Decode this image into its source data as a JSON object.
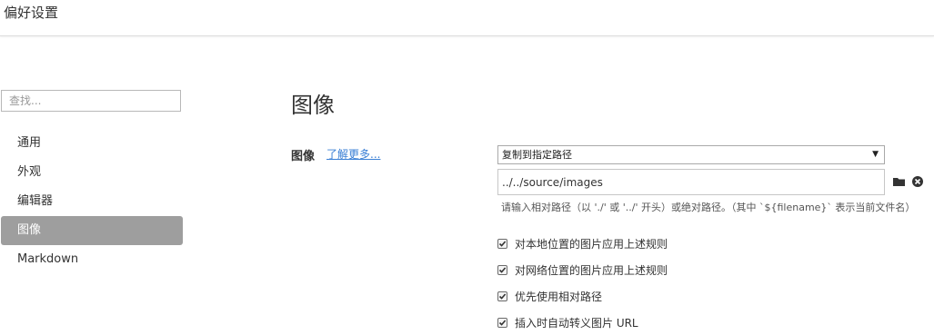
{
  "window": {
    "title": "偏好设置"
  },
  "sidebar": {
    "search_placeholder": "查找...",
    "items": [
      {
        "label": "通用",
        "active": false
      },
      {
        "label": "外观",
        "active": false
      },
      {
        "label": "编辑器",
        "active": false
      },
      {
        "label": "图像",
        "active": true
      },
      {
        "label": "Markdown",
        "active": false
      }
    ]
  },
  "main": {
    "heading": "图像",
    "image_label": "图像",
    "learn_more": "了解更多...",
    "action_select": {
      "value": "复制到指定路径",
      "arrow": "▼"
    },
    "path_input": {
      "value": "../../source/images"
    },
    "hint": "请输入相对路径（以 './' 或 '../' 开头）或绝对路径。（其中 `${filename}` 表示当前文件名）",
    "checkboxes": [
      {
        "label": "对本地位置的图片应用上述规则",
        "checked": true
      },
      {
        "label": "对网络位置的图片应用上述规则",
        "checked": true
      },
      {
        "label": "优先使用相对路径",
        "checked": true
      },
      {
        "label": "插入时自动转义图片 URL",
        "checked": true
      }
    ]
  },
  "colors": {
    "active_nav_bg": "#9e9e9e",
    "link": "#3a7fd5"
  },
  "icons": {
    "browse": "folder-icon",
    "clear": "clear-icon"
  }
}
